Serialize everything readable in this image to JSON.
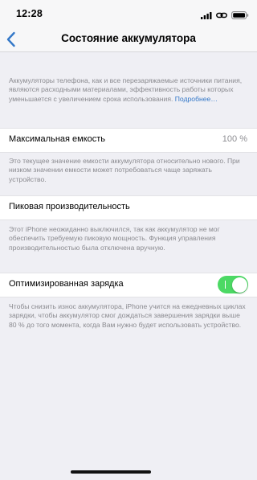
{
  "status_bar": {
    "time": "12:28"
  },
  "nav": {
    "title": "Состояние аккумулятора",
    "back_icon": "chevron-left-icon"
  },
  "intro": {
    "text": "Аккумуляторы телефона, как и все перезаряжаемые источники питания, являются расходными материалами, эффективность работы которых уменьшается с увеличением срока использования. ",
    "link": "Подробнее…"
  },
  "max_capacity": {
    "label": "Максимальная емкость",
    "value": "100 %",
    "footnote": "Это текущее значение емкости аккумулятора относительно нового. При низком значении емкости может потребоваться чаще заряжать устройство."
  },
  "peak_performance": {
    "label": "Пиковая производительность",
    "footnote": "Этот iPhone неожиданно выключился, так как аккумулятор не мог обеспечить требуемую пиковую мощность. Функция управления производительностью была отключена вручную."
  },
  "optimized_charging": {
    "label": "Оптимизированная зарядка",
    "enabled": true,
    "toggle_color": "#4cd964",
    "footnote": "Чтобы снизить износ аккумулятора, iPhone учится на ежедневных циклах зарядки, чтобы аккумулятор смог дождаться завершения зарядки выше 80 % до того момента, когда Вам нужно будет использовать устройство."
  },
  "colors": {
    "accent": "#3478c8",
    "background": "#efeff4",
    "footnote_text": "#8a8a8f"
  }
}
